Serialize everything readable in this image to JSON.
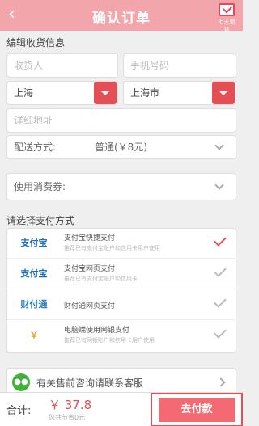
{
  "header": {
    "title": "确认订单",
    "sms_label": "七天退货"
  },
  "address": {
    "section_title": "编辑收货信息",
    "name_placeholder": "收货人",
    "phone_placeholder": "手机号码",
    "province": "上海",
    "city": "上海市",
    "detail_placeholder": "详细地址"
  },
  "shipping": {
    "label": "配送方式:",
    "value": "普通(￥8元)"
  },
  "coupon": {
    "label": "使用消费券:"
  },
  "payment": {
    "section_title": "请选择支付方式",
    "methods": [
      {
        "logo": "支付宝",
        "title": "支付宝快捷支付",
        "sub": "推荐已有支付宝账户和信用卡用户使用",
        "selected": true
      },
      {
        "logo": "支付宝",
        "title": "支付宝网页支付",
        "sub": "推荐已有支付宝账户和信用卡",
        "selected": false
      },
      {
        "logo": "财付通",
        "title": "财付通网页支付",
        "sub": "",
        "selected": false
      },
      {
        "logo": "￥",
        "title": "电脑端使用网银支付",
        "sub": "推荐已有网银账户和信用卡用户使用",
        "selected": false
      }
    ]
  },
  "chat": {
    "label": "有关售前咨询请联系客服"
  },
  "footer": {
    "total_label": "合计:",
    "amount": "￥ 37.8",
    "savings": "您共节省0元",
    "pay_button": "去付款"
  },
  "colors": {
    "accent": "#e34f54",
    "header": "#f2a6ab"
  }
}
